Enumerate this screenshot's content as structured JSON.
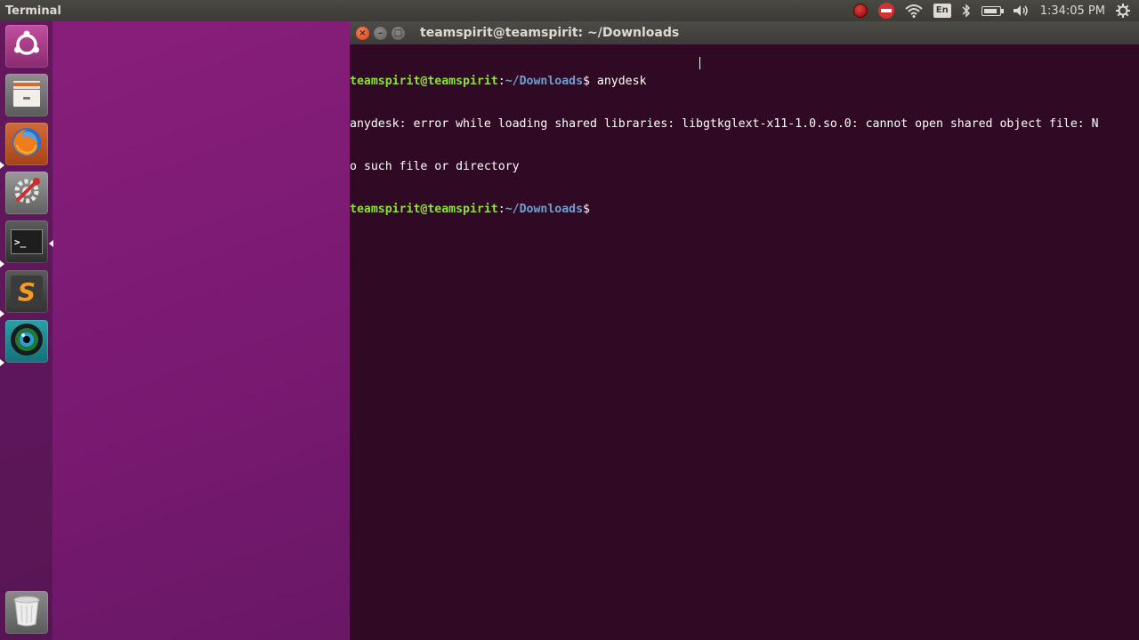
{
  "top_panel": {
    "app_title": "Terminal",
    "indicators": {
      "keyboard_layout": "En",
      "clock": "1:34:05 PM"
    }
  },
  "launcher": {
    "items": [
      {
        "name": "dash-home",
        "icon": "ubuntu-logo-icon"
      },
      {
        "name": "files",
        "icon": "file-cabinet-icon"
      },
      {
        "name": "firefox",
        "icon": "firefox-icon"
      },
      {
        "name": "system-settings",
        "icon": "settings-wrench-icon"
      },
      {
        "name": "terminal",
        "icon": "terminal-icon",
        "label": ">_"
      },
      {
        "name": "sublime-text",
        "icon": "sublime-text-icon",
        "label": "S"
      },
      {
        "name": "camera-app",
        "icon": "camera-lens-icon"
      },
      {
        "name": "trash",
        "icon": "trash-icon"
      }
    ]
  },
  "terminal": {
    "window_title": "teamspirit@teamspirit: ~/Downloads",
    "lines": [
      {
        "user_host": "teamspirit@teamspirit",
        "sep": ":",
        "path": "~/Downloads",
        "prompt": "$ ",
        "command": "anydesk"
      },
      {
        "text": "anydesk: error while loading shared libraries: libgtkglext-x11-1.0.so.0: cannot open shared object file: N"
      },
      {
        "text": "o such file or directory"
      },
      {
        "user_host": "teamspirit@teamspirit",
        "sep": ":",
        "path": "~/Downloads",
        "prompt": "$",
        "command": ""
      }
    ]
  },
  "colors": {
    "terminal_bg": "#300a24",
    "prompt_user": "#8ae234",
    "prompt_path": "#729fcf",
    "panel_bg": "#3c3b37",
    "close_button": "#d64415"
  }
}
